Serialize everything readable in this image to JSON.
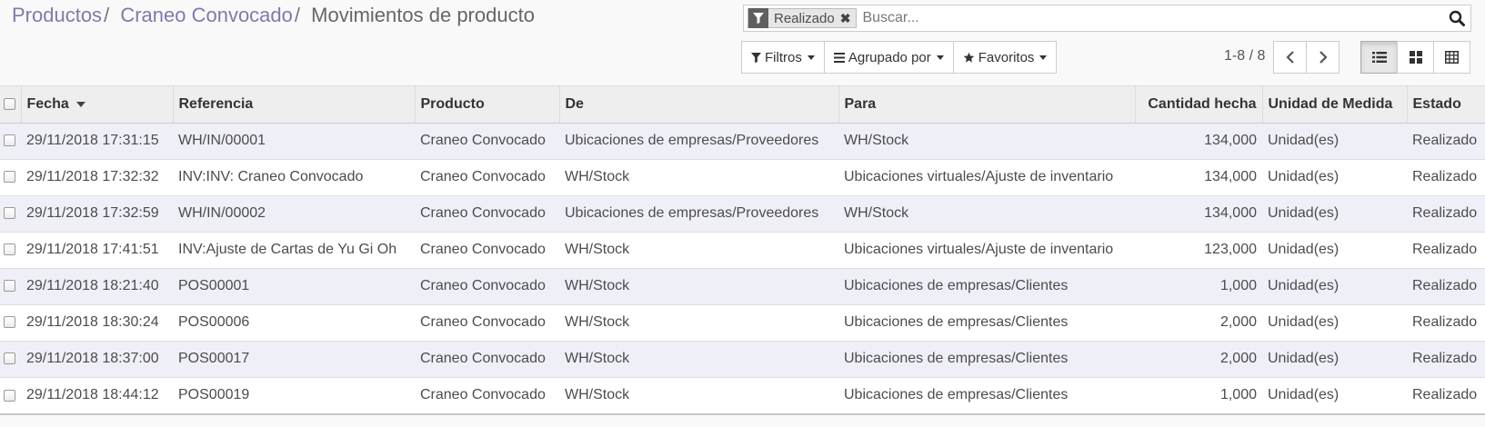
{
  "breadcrumb": {
    "items": [
      "Productos",
      "Craneo Convocado"
    ],
    "current": "Movimientos de producto",
    "separator": "/"
  },
  "search": {
    "facet_value": "Realizado",
    "facet_icon": "filter-icon",
    "facet_remove": "✖",
    "placeholder": "Buscar..."
  },
  "toolbar": {
    "filters_label": "Filtros",
    "group_by_label": "Agrupado por",
    "favorites_label": "Favoritos"
  },
  "pager": {
    "value": "1-8 / 8"
  },
  "views": [
    "list-view-icon",
    "kanban-view-icon",
    "pivot-view-icon"
  ],
  "table": {
    "columns": [
      "Fecha",
      "Referencia",
      "Producto",
      "De",
      "Para",
      "Cantidad hecha",
      "Unidad de Medida",
      "Estado"
    ],
    "sorted_column": "Fecha",
    "rows": [
      [
        "29/11/2018 17:31:15",
        "WH/IN/00001",
        "Craneo Convocado",
        "Ubicaciones de empresas/Proveedores",
        "WH/Stock",
        "134,000",
        "Unidad(es)",
        "Realizado"
      ],
      [
        "29/11/2018 17:32:32",
        "INV:INV: Craneo Convocado",
        "Craneo Convocado",
        "WH/Stock",
        "Ubicaciones virtuales/Ajuste de inventario",
        "134,000",
        "Unidad(es)",
        "Realizado"
      ],
      [
        "29/11/2018 17:32:59",
        "WH/IN/00002",
        "Craneo Convocado",
        "Ubicaciones de empresas/Proveedores",
        "WH/Stock",
        "134,000",
        "Unidad(es)",
        "Realizado"
      ],
      [
        "29/11/2018 17:41:51",
        "INV:Ajuste de Cartas de Yu Gi Oh",
        "Craneo Convocado",
        "WH/Stock",
        "Ubicaciones virtuales/Ajuste de inventario",
        "123,000",
        "Unidad(es)",
        "Realizado"
      ],
      [
        "29/11/2018 18:21:40",
        "POS00001",
        "Craneo Convocado",
        "WH/Stock",
        "Ubicaciones de empresas/Clientes",
        "1,000",
        "Unidad(es)",
        "Realizado"
      ],
      [
        "29/11/2018 18:30:24",
        "POS00006",
        "Craneo Convocado",
        "WH/Stock",
        "Ubicaciones de empresas/Clientes",
        "2,000",
        "Unidad(es)",
        "Realizado"
      ],
      [
        "29/11/2018 18:37:00",
        "POS00017",
        "Craneo Convocado",
        "WH/Stock",
        "Ubicaciones de empresas/Clientes",
        "2,000",
        "Unidad(es)",
        "Realizado"
      ],
      [
        "29/11/2018 18:44:12",
        "POS00019",
        "Craneo Convocado",
        "WH/Stock",
        "Ubicaciones de empresas/Clientes",
        "1,000",
        "Unidad(es)",
        "Realizado"
      ]
    ]
  },
  "colors": {
    "breadcrumb_link": "#7c7bad",
    "row_stripe": "#efeff8",
    "header_bg": "#eeeeee"
  }
}
